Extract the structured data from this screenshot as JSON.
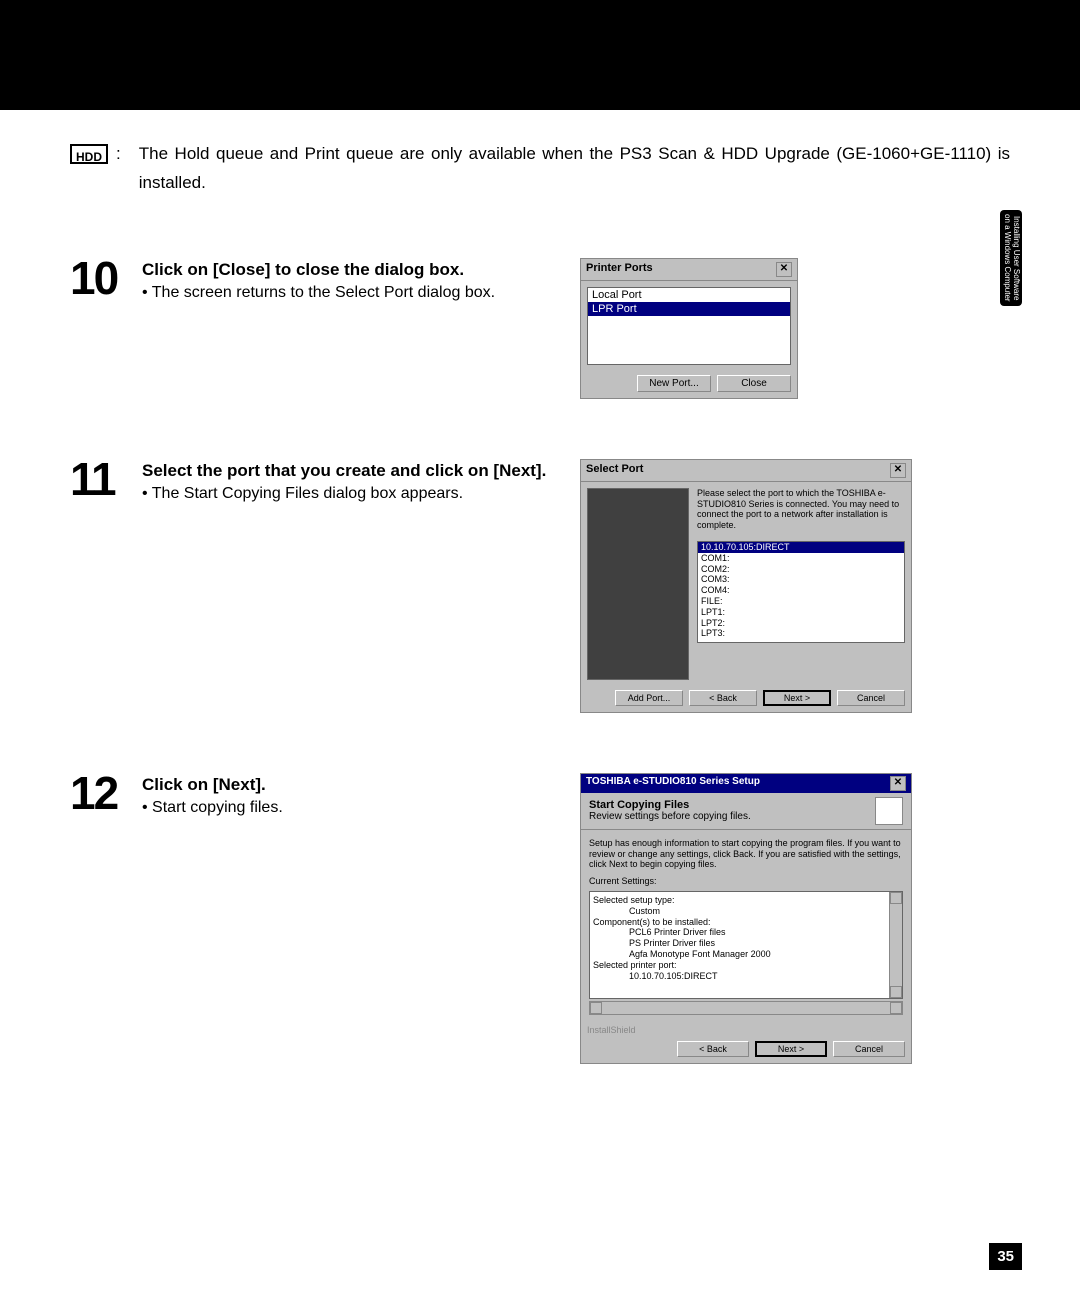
{
  "sideTab": "Installing User Software on a Windows Computer",
  "hdd": {
    "icon": "HDD",
    "colon": ":",
    "text": "The Hold queue and Print queue are only available when the PS3 Scan & HDD Upgrade (GE-1060+GE-1110) is installed."
  },
  "steps": {
    "s10": {
      "num": "10",
      "head": "Click on [Close] to close the dialog box.",
      "sub": "The screen returns to the Select Port dialog box."
    },
    "s11": {
      "num": "11",
      "head": "Select the port that you create and click on [Next].",
      "sub": "The Start Copying Files dialog box appears."
    },
    "s12": {
      "num": "12",
      "head": "Click on [Next].",
      "sub": "Start copying files."
    }
  },
  "dlg_pp": {
    "title": "Printer Ports",
    "items": {
      "a": "Local Port",
      "b": "LPR Port"
    },
    "new_port": "New Port...",
    "close": "Close"
  },
  "dlg_sp": {
    "title": "Select Port",
    "desc": "Please select the port to which the TOSHIBA e-STUDIO810 Series is connected. You may need to connect the port to a network after installation is complete.",
    "sel": "10.10.70.105:DIRECT",
    "items": {
      "a": "COM1:",
      "b": "COM2:",
      "c": "COM3:",
      "d": "COM4:",
      "e": "FILE:",
      "f": "LPT1:",
      "g": "LPT2:",
      "h": "LPT3:"
    },
    "add_port": "Add Port...",
    "back": "< Back",
    "next": "Next >",
    "cancel": "Cancel"
  },
  "dlg_scf": {
    "title": "TOSHIBA e-STUDIO810 Series Setup",
    "h1": "Start Copying Files",
    "h2": "Review settings before copying files.",
    "desc": "Setup has enough information to start copying the program files.  If you want to review or change any settings, click Back.  If you are satisfied with the settings, click Next to begin copying files.",
    "cs_label": "Current Settings:",
    "settings": {
      "a": "Selected setup type:",
      "a1": "Custom",
      "b": "Component(s) to be installed:",
      "b1": "PCL6 Printer Driver files",
      "b2": "PS Printer Driver files",
      "b3": "Agfa Monotype Font Manager 2000",
      "c": "Selected printer port:",
      "c1": "10.10.70.105:DIRECT"
    },
    "footer_tag": "InstallShield",
    "back": "< Back",
    "next": "Next >",
    "cancel": "Cancel"
  },
  "pageNum": "35"
}
